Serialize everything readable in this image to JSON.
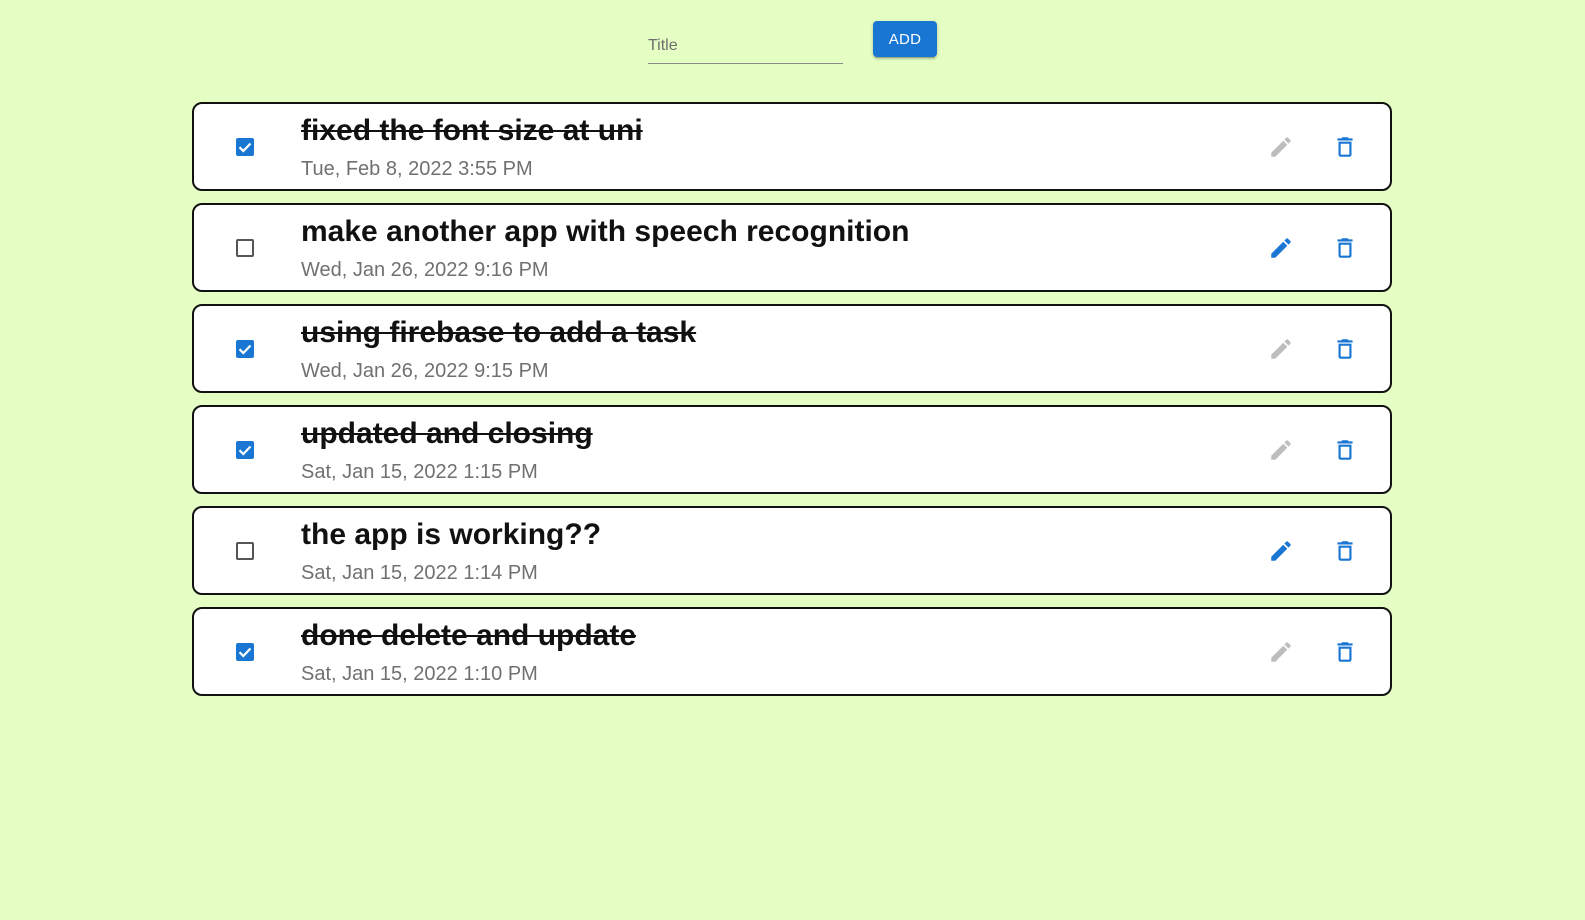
{
  "add_form": {
    "title_placeholder": "Title",
    "title_value": "",
    "add_label": "ADD"
  },
  "colors": {
    "background": "#e5fec3",
    "accent": "#1976d2",
    "disabled_icon": "#bdbdbd"
  },
  "todos": [
    {
      "title": "fixed the font size at uni",
      "date": "Tue, Feb 8, 2022 3:55 PM",
      "completed": true
    },
    {
      "title": "make another app with speech recognition",
      "date": "Wed, Jan 26, 2022 9:16 PM",
      "completed": false
    },
    {
      "title": "using firebase to add a task",
      "date": "Wed, Jan 26, 2022 9:15 PM",
      "completed": true
    },
    {
      "title": "updated and closing",
      "date": "Sat, Jan 15, 2022 1:15 PM",
      "completed": true
    },
    {
      "title": "the app is working??",
      "date": "Sat, Jan 15, 2022 1:14 PM",
      "completed": false
    },
    {
      "title": "done delete and update",
      "date": "Sat, Jan 15, 2022 1:10 PM",
      "completed": true
    }
  ],
  "icons": {
    "checkbox_checked": "check-icon",
    "edit": "pencil-icon",
    "delete": "trash-icon"
  }
}
